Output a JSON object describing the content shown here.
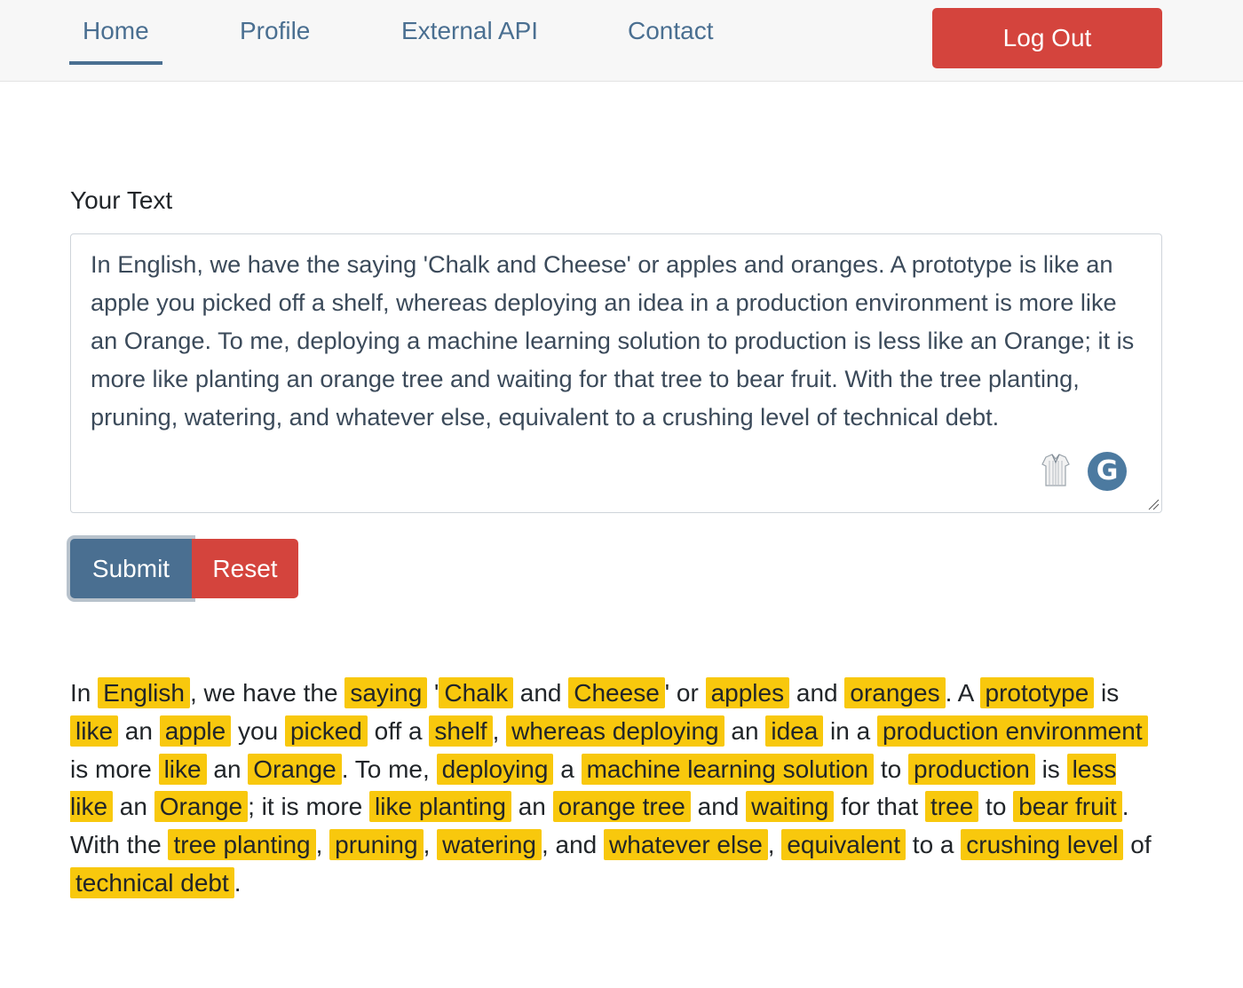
{
  "nav": {
    "items": [
      {
        "label": "Home",
        "active": true
      },
      {
        "label": "Profile",
        "active": false
      },
      {
        "label": "External API",
        "active": false
      },
      {
        "label": "Contact",
        "active": false
      }
    ],
    "logout_label": "Log Out"
  },
  "form": {
    "label": "Your Text",
    "value": "In English, we have the saying 'Chalk and Cheese' or apples and oranges. A prototype is like an apple you picked off a shelf, whereas deploying an idea in a production environment is more like an Orange. To me, deploying a machine learning solution to production is less like an Orange; it is more like planting an orange tree and waiting for that tree to bear fruit. With the tree planting, pruning, watering, and whatever else, equivalent to a crushing level of technical debt.",
    "grammarly_glyph": "G",
    "submit_label": "Submit",
    "reset_label": "Reset"
  },
  "colors": {
    "accent": "#4a6f91",
    "danger": "#d4443d",
    "highlight": "#f8c80d"
  },
  "result": {
    "segments": [
      {
        "t": "In ",
        "h": false
      },
      {
        "t": "English",
        "h": true
      },
      {
        "t": ", we have the ",
        "h": false
      },
      {
        "t": "saying",
        "h": true
      },
      {
        "t": " '",
        "h": false
      },
      {
        "t": "Chalk",
        "h": true
      },
      {
        "t": " and ",
        "h": false
      },
      {
        "t": "Cheese",
        "h": true
      },
      {
        "t": "' or ",
        "h": false
      },
      {
        "t": "apples",
        "h": true
      },
      {
        "t": " and ",
        "h": false
      },
      {
        "t": "oranges",
        "h": true
      },
      {
        "t": ". A ",
        "h": false
      },
      {
        "t": "prototype",
        "h": true
      },
      {
        "t": " is ",
        "h": false
      },
      {
        "t": "like",
        "h": true
      },
      {
        "t": " an ",
        "h": false
      },
      {
        "t": "apple",
        "h": true
      },
      {
        "t": " you ",
        "h": false
      },
      {
        "t": "picked",
        "h": true
      },
      {
        "t": " off a ",
        "h": false
      },
      {
        "t": "shelf",
        "h": true
      },
      {
        "t": ", ",
        "h": false
      },
      {
        "t": "whereas deploying",
        "h": true
      },
      {
        "t": " an ",
        "h": false
      },
      {
        "t": "idea",
        "h": true
      },
      {
        "t": " in a ",
        "h": false
      },
      {
        "t": "production environment",
        "h": true
      },
      {
        "t": " is more ",
        "h": false
      },
      {
        "t": "like",
        "h": true
      },
      {
        "t": " an ",
        "h": false
      },
      {
        "t": "Orange",
        "h": true
      },
      {
        "t": ". To me, ",
        "h": false
      },
      {
        "t": "deploying",
        "h": true
      },
      {
        "t": " a ",
        "h": false
      },
      {
        "t": "machine learning solution",
        "h": true
      },
      {
        "t": " to ",
        "h": false
      },
      {
        "t": "production",
        "h": true
      },
      {
        "t": " is ",
        "h": false
      },
      {
        "t": "less like",
        "h": true
      },
      {
        "t": " an ",
        "h": false
      },
      {
        "t": "Orange",
        "h": true
      },
      {
        "t": "; it is more ",
        "h": false
      },
      {
        "t": "like planting",
        "h": true
      },
      {
        "t": " an ",
        "h": false
      },
      {
        "t": "orange tree",
        "h": true
      },
      {
        "t": " and ",
        "h": false
      },
      {
        "t": "waiting",
        "h": true
      },
      {
        "t": " for that ",
        "h": false
      },
      {
        "t": "tree",
        "h": true
      },
      {
        "t": " to ",
        "h": false
      },
      {
        "t": "bear fruit",
        "h": true
      },
      {
        "t": ". With the ",
        "h": false
      },
      {
        "t": "tree planting",
        "h": true
      },
      {
        "t": ", ",
        "h": false
      },
      {
        "t": "pruning",
        "h": true
      },
      {
        "t": ", ",
        "h": false
      },
      {
        "t": "watering",
        "h": true
      },
      {
        "t": ", and ",
        "h": false
      },
      {
        "t": "whatever else",
        "h": true
      },
      {
        "t": ", ",
        "h": false
      },
      {
        "t": "equivalent",
        "h": true
      },
      {
        "t": " to a ",
        "h": false
      },
      {
        "t": "crushing level",
        "h": true
      },
      {
        "t": " of ",
        "h": false
      },
      {
        "t": "technical debt",
        "h": true
      },
      {
        "t": ".",
        "h": false
      }
    ]
  }
}
